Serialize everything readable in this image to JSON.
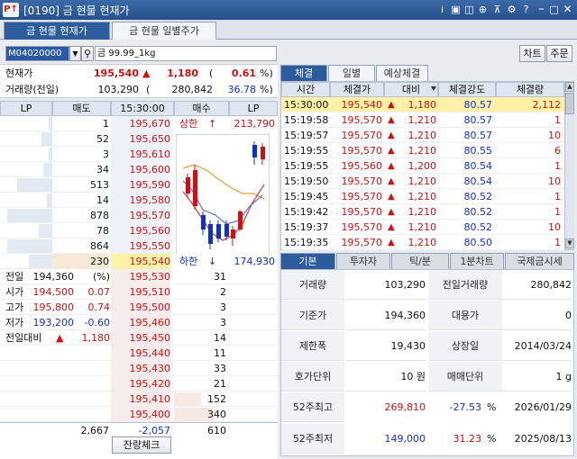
{
  "window": {
    "logo": "P↑",
    "title": "[0190] 금 현물 현재가",
    "icons": [
      "panel-icon",
      "link-icon",
      "screenshot-icon",
      "search-icon",
      "pin-icon",
      "settings-icon",
      "help-icon"
    ],
    "title_icon_glyphs": [
      "i",
      "▣",
      "◫",
      "⊕",
      "⊼",
      "⚙",
      "?"
    ]
  },
  "tabs": [
    {
      "label": "금 현물 현재가",
      "active": true
    },
    {
      "label": "금 현물 일별주가",
      "active": false
    }
  ],
  "search": {
    "code": "M04020000",
    "name": "금 99.99_1kg"
  },
  "top_buttons": {
    "chart": "차트",
    "order": "주문"
  },
  "summary": {
    "price_label": "현재가",
    "price": "195,540",
    "arrow": "▲",
    "change": "1,180",
    "paren_open": "(",
    "pct": "0.61",
    "pct_unit": "%)",
    "vol_label": "거래량(전일)",
    "volume": "103,290",
    "paren_open2": "(",
    "prev_volume": "280,842",
    "vol_ratio": "36.78",
    "vol_unit": "%)"
  },
  "orderbook": {
    "headers": [
      "LP",
      "매도",
      "15:30:00",
      "매수",
      "LP"
    ],
    "asks": [
      {
        "qty": "1",
        "price": "195,670"
      },
      {
        "qty": "52",
        "price": "195,650"
      },
      {
        "qty": "3",
        "price": "195,610"
      },
      {
        "qty": "34",
        "price": "195,600"
      },
      {
        "qty": "513",
        "price": "195,590"
      },
      {
        "qty": "14",
        "price": "195,580"
      },
      {
        "qty": "878",
        "price": "195,570"
      },
      {
        "qty": "78",
        "price": "195,560"
      },
      {
        "qty": "864",
        "price": "195,550"
      },
      {
        "qty": "230",
        "price": "195,540"
      }
    ],
    "bids": [
      {
        "price": "195,530",
        "qty": "31"
      },
      {
        "price": "195,510",
        "qty": "2"
      },
      {
        "price": "195,500",
        "qty": "3"
      },
      {
        "price": "195,460",
        "qty": "3"
      },
      {
        "price": "195,450",
        "qty": "14"
      },
      {
        "price": "195,440",
        "qty": "11"
      },
      {
        "price": "195,430",
        "qty": "33"
      },
      {
        "price": "195,420",
        "qty": "21"
      },
      {
        "price": "195,410",
        "qty": "152"
      },
      {
        "price": "195,400",
        "qty": "340"
      }
    ],
    "upper_limit_label": "상한",
    "upper_arrow": "↑",
    "upper_limit": "213,790",
    "lower_limit_label": "하한",
    "lower_arrow": "↓",
    "lower_limit": "174,930",
    "stats": [
      {
        "label": "전일",
        "value": "194,360",
        "extra": "(%)"
      },
      {
        "label": "시가",
        "value": "194,500",
        "extra": "0.07"
      },
      {
        "label": "고가",
        "value": "195,800",
        "extra": "0.74"
      },
      {
        "label": "저가",
        "value": "193,200",
        "extra": "-0.60"
      },
      {
        "label": "전일대비",
        "value": "▲",
        "extra": "1,180"
      }
    ],
    "total_ask": "2,667",
    "diff": "-2,057",
    "total_bid": "610",
    "residual_button": "잔량체크"
  },
  "trade_tabs": [
    "체결",
    "일별",
    "예상체결"
  ],
  "trades": {
    "headers": [
      "시간",
      "체결가",
      "대비",
      "체결강도",
      "체결량"
    ],
    "rows": [
      [
        "15:30:00",
        "195,540",
        "1,180",
        "80.57",
        "2,112"
      ],
      [
        "15:19:58",
        "195,570",
        "1,210",
        "80.57",
        "1"
      ],
      [
        "15:19:57",
        "195,570",
        "1,210",
        "80.57",
        "10"
      ],
      [
        "15:19:55",
        "195,570",
        "1,210",
        "80.55",
        "6"
      ],
      [
        "15:19:55",
        "195,560",
        "1,200",
        "80.54",
        "1"
      ],
      [
        "15:19:50",
        "195,570",
        "1,210",
        "80.54",
        "10"
      ],
      [
        "15:19:45",
        "195,570",
        "1,210",
        "80.52",
        "1"
      ],
      [
        "15:19:42",
        "195,570",
        "1,210",
        "80.52",
        "1"
      ],
      [
        "15:19:37",
        "195,570",
        "1,210",
        "80.52",
        "10"
      ],
      [
        "15:19:35",
        "195,570",
        "1,210",
        "80.50",
        "1"
      ]
    ]
  },
  "info_tabs": [
    "기본",
    "투자자",
    "틱/분",
    "1분차트",
    "국제금시세"
  ],
  "info": [
    {
      "l1": "거래량",
      "v1": "103,290",
      "l2": "전일거래량",
      "v2": "280,842"
    },
    {
      "l1": "기준가",
      "v1": "194,360",
      "l2": "대용가",
      "v2": "0"
    },
    {
      "l1": "제한폭",
      "v1": "19,430",
      "l2": "상장일",
      "v2": "2014/03/24"
    },
    {
      "l1": "호가단위",
      "v1": "10 원",
      "l2": "매매단위",
      "v2": "1  g"
    }
  ],
  "week52": [
    {
      "label": "52주최고",
      "price": "269,810",
      "pct": "-27.53",
      "unit": "%",
      "date": "2026/01/29"
    },
    {
      "label": "52주최저",
      "price": "149,000",
      "pct": "31.23",
      "unit": "%",
      "date": "2025/08/13"
    }
  ],
  "colors": {
    "up": "#d01010",
    "down": "#1030c8",
    "title": "#26508c",
    "ask_bg": "#e3e9f3",
    "bid_bg": "#f7e8e1"
  }
}
